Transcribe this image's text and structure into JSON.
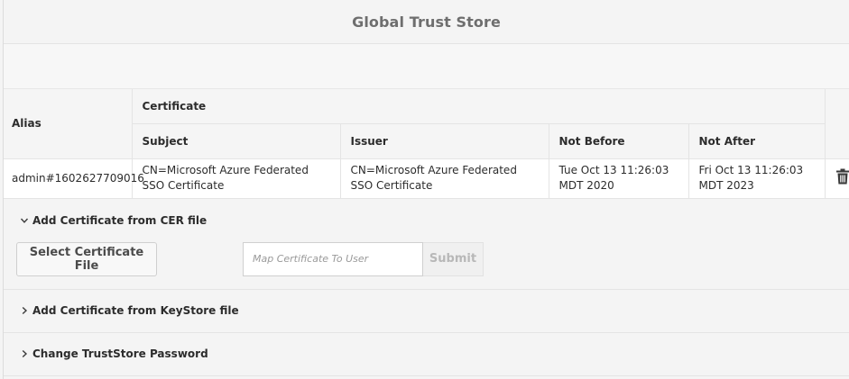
{
  "header": {
    "title": "Global Trust Store"
  },
  "table": {
    "alias_header": "Alias",
    "certificate_header": "Certificate",
    "columns": [
      "Subject",
      "Issuer",
      "Not Before",
      "Not After"
    ],
    "rows": [
      {
        "alias": "admin#1602627709016",
        "subject": "CN=Microsoft Azure Federated SSO Certificate",
        "issuer": "CN=Microsoft Azure Federated SSO Certificate",
        "not_before": "Tue Oct 13 11:26:03 MDT 2020",
        "not_after": "Fri Oct 13 11:26:03 MDT 2023",
        "delete_icon": "trash-icon"
      }
    ]
  },
  "cer_section": {
    "title": "Add Certificate from CER file",
    "expanded": true,
    "select_button": "Select Certificate File",
    "map_placeholder": "Map Certificate To User",
    "map_value": "",
    "submit_button": "Submit"
  },
  "keystore_section": {
    "title": "Add Certificate from KeyStore file",
    "expanded": false
  },
  "password_section": {
    "title": "Change TrustStore Password",
    "expanded": false
  },
  "colors": {
    "background": "#f4f4f4",
    "row": "#ffffff",
    "border": "#e4e4e4",
    "title": "#6e6e6e",
    "disabled": "#b8b8b8"
  }
}
